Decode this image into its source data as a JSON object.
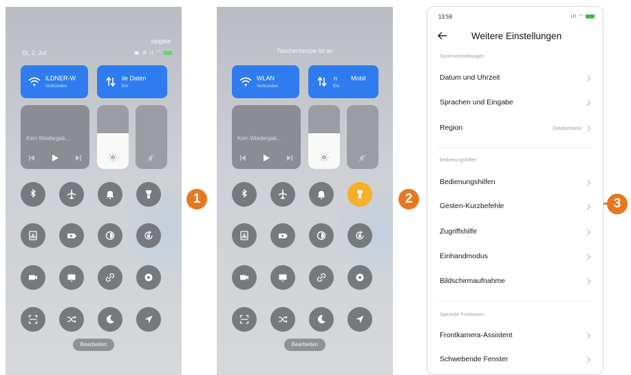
{
  "panel1": {
    "top_right": "sipgate",
    "date": "Di, 2. Jul",
    "wlan_title": "lLDNER-W",
    "wlan_sub": "Verbunden",
    "data_title": "ile Daten",
    "data_sub": "Ein",
    "media_label": "Kein Wiedergab...",
    "brightness_level": 0.56,
    "edit_label": "Bearbeiten"
  },
  "panel2": {
    "torch_status": "Taschenlampe ist an",
    "wlan_title": "WLAN",
    "wlan_sub": "Verbunden",
    "data_title": "Mobil",
    "data_title_prefix": "n",
    "data_sub": "Ein",
    "media_label": "Kein Wiedergab...",
    "brightness_level": 0.56,
    "edit_label": "Bearbeiten",
    "flashlight_on": true
  },
  "buttons": [
    "bluetooth-icon",
    "airplane-icon",
    "bell-icon",
    "flashlight-icon",
    "screenshot-icon",
    "battery-saver-icon",
    "reading-mode-icon",
    "rotation-lock-icon",
    "screen-record-icon",
    "cast-icon",
    "link-icon",
    "settings-dot-icon",
    "scan-icon",
    "shuffle-icon",
    "moon-icon",
    "location-icon"
  ],
  "markers": {
    "m1": "1",
    "m2": "2",
    "m3": "3"
  },
  "marker_color": "#e87722",
  "accent_blue": "#2f7cf1",
  "torch_on_color": "#f6b02a",
  "settings": {
    "time": "13:59",
    "title": "Weitere Einstellungen",
    "sections": [
      {
        "label": "Systemeinstellungen",
        "rows": [
          {
            "label": "Datum und Uhrzeit",
            "value": ""
          },
          {
            "label": "Sprachen und Eingabe",
            "value": ""
          },
          {
            "label": "Region",
            "value": "Deutschland"
          }
        ]
      },
      {
        "label": "Bedienungshilfen",
        "rows": [
          {
            "label": "Bedienungshilfen",
            "value": ""
          },
          {
            "label": "Gesten-Kurzbefehle",
            "value": ""
          },
          {
            "label": "Zugriffshilfe",
            "value": ""
          },
          {
            "label": "Einhandmodus",
            "value": ""
          },
          {
            "label": "Bildschirmaufnahme",
            "value": ""
          }
        ]
      },
      {
        "label": "Spezielle Funktionen",
        "rows": [
          {
            "label": "Frontkamera-Assistent",
            "value": ""
          },
          {
            "label": "Schwebende Fenster",
            "value": ""
          }
        ]
      }
    ]
  }
}
